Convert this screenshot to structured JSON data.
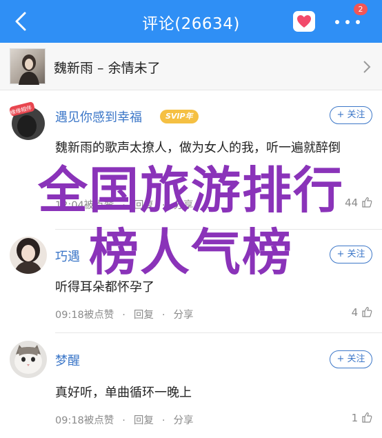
{
  "header": {
    "title": "评论(26634)",
    "badge_count": "2",
    "back_icon": "chevron-left-icon",
    "like_icon": "heart-chat-icon",
    "more_icon": "more-dots-icon"
  },
  "song": {
    "title": "魏新雨 – 余情未了",
    "chevron_icon": "chevron-right-icon"
  },
  "comments": [
    {
      "username": "遇见你感到幸福",
      "vip": "SVIP年",
      "follow": "+ 关注",
      "text": "魏新雨的歌声太撩人，做为女人的我，听一遍就醉倒",
      "time": "12:04被点赞",
      "reply": "回复",
      "share": "分享",
      "likes": "44"
    },
    {
      "username": "巧遇",
      "follow": "+ 关注",
      "text": "听得耳朵都怀孕了",
      "time": "09:18被点赞",
      "reply": "回复",
      "share": "分享",
      "likes": "4"
    },
    {
      "username": "梦醒",
      "follow": "+ 关注",
      "text": "真好听，单曲循环一晚上",
      "time": "09:18被点赞",
      "reply": "回复",
      "share": "分享",
      "likes": "1"
    }
  ],
  "overlay": {
    "line1": "全国旅游排行",
    "line2": "榜人气榜"
  },
  "colors": {
    "topbar": "#2f8ff5",
    "username": "#3c77c8",
    "overlay": "#8a33b9",
    "badge": "#f25656",
    "vip": "#f5c043"
  }
}
